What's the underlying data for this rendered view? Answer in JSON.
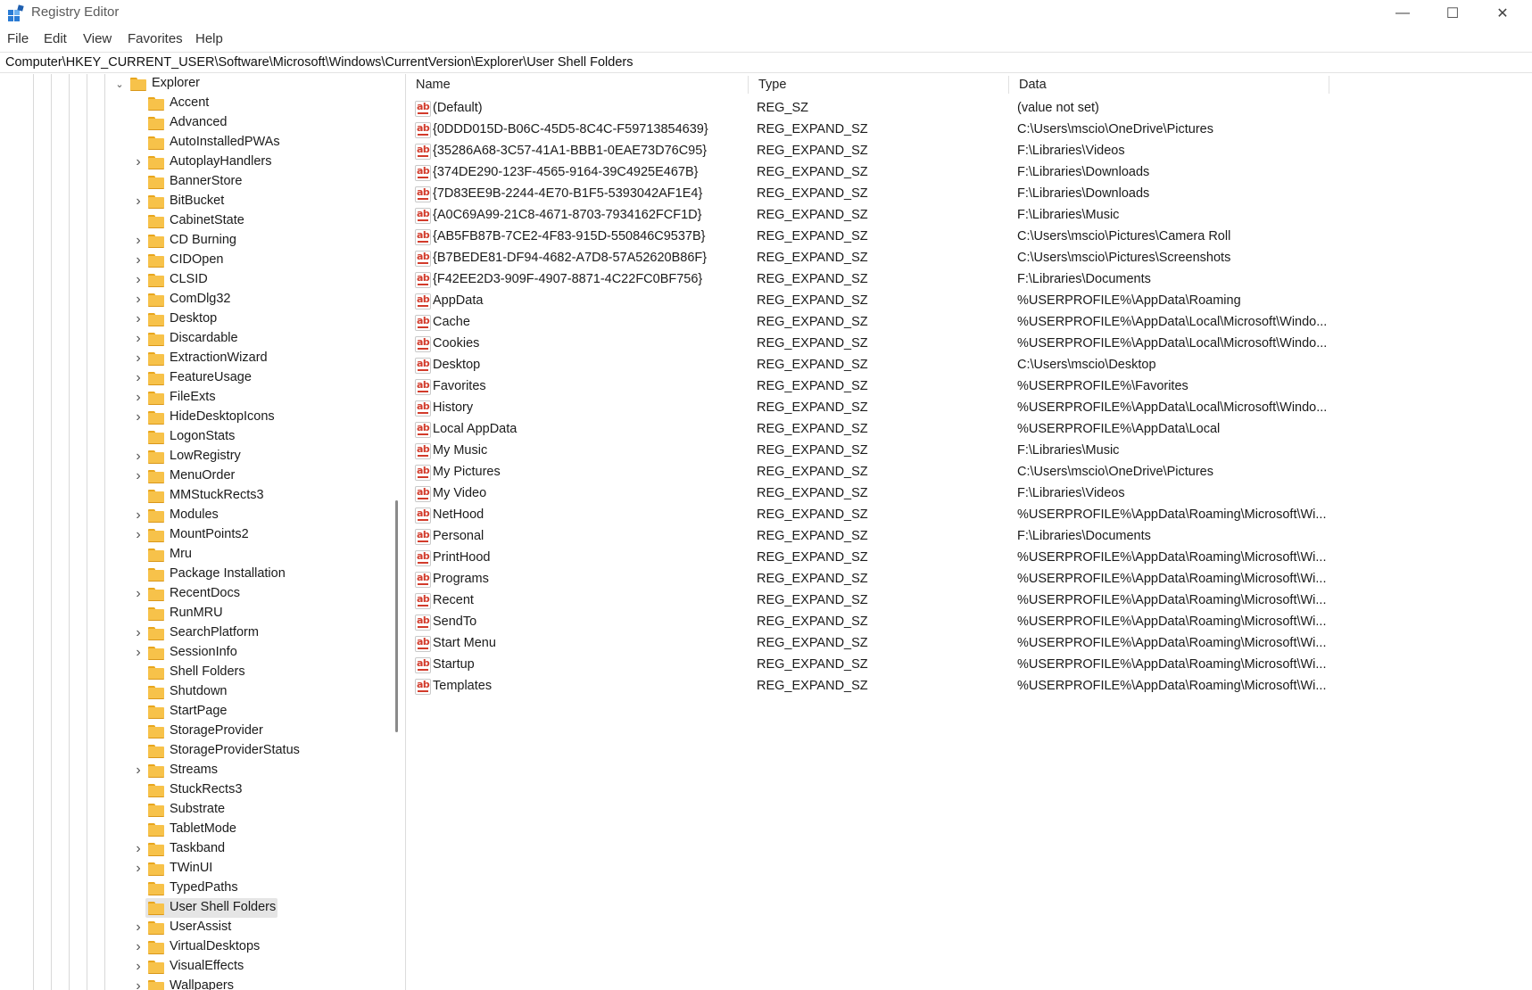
{
  "window": {
    "title": "Registry Editor",
    "minimize": "—",
    "maximize": "☐",
    "close": "✕"
  },
  "menu": [
    "File",
    "Edit",
    "View",
    "Favorites",
    "Help"
  ],
  "address": "Computer\\HKEY_CURRENT_USER\\Software\\Microsoft\\Windows\\CurrentVersion\\Explorer\\User Shell Folders",
  "tree": {
    "parent": {
      "label": "Explorer",
      "expanded": true
    },
    "children": [
      {
        "label": "Accent",
        "expandable": false
      },
      {
        "label": "Advanced",
        "expandable": false
      },
      {
        "label": "AutoInstalledPWAs",
        "expandable": false
      },
      {
        "label": "AutoplayHandlers",
        "expandable": true
      },
      {
        "label": "BannerStore",
        "expandable": false
      },
      {
        "label": "BitBucket",
        "expandable": true
      },
      {
        "label": "CabinetState",
        "expandable": false
      },
      {
        "label": "CD Burning",
        "expandable": true
      },
      {
        "label": "CIDOpen",
        "expandable": true
      },
      {
        "label": "CLSID",
        "expandable": true
      },
      {
        "label": "ComDlg32",
        "expandable": true
      },
      {
        "label": "Desktop",
        "expandable": true
      },
      {
        "label": "Discardable",
        "expandable": true
      },
      {
        "label": "ExtractionWizard",
        "expandable": true
      },
      {
        "label": "FeatureUsage",
        "expandable": true
      },
      {
        "label": "FileExts",
        "expandable": true
      },
      {
        "label": "HideDesktopIcons",
        "expandable": true
      },
      {
        "label": "LogonStats",
        "expandable": false
      },
      {
        "label": "LowRegistry",
        "expandable": true
      },
      {
        "label": "MenuOrder",
        "expandable": true
      },
      {
        "label": "MMStuckRects3",
        "expandable": false
      },
      {
        "label": "Modules",
        "expandable": true
      },
      {
        "label": "MountPoints2",
        "expandable": true
      },
      {
        "label": "Mru",
        "expandable": false
      },
      {
        "label": "Package Installation",
        "expandable": false
      },
      {
        "label": "RecentDocs",
        "expandable": true
      },
      {
        "label": "RunMRU",
        "expandable": false
      },
      {
        "label": "SearchPlatform",
        "expandable": true
      },
      {
        "label": "SessionInfo",
        "expandable": true
      },
      {
        "label": "Shell Folders",
        "expandable": false
      },
      {
        "label": "Shutdown",
        "expandable": false
      },
      {
        "label": "StartPage",
        "expandable": false
      },
      {
        "label": "StorageProvider",
        "expandable": false
      },
      {
        "label": "StorageProviderStatus",
        "expandable": false
      },
      {
        "label": "Streams",
        "expandable": true
      },
      {
        "label": "StuckRects3",
        "expandable": false
      },
      {
        "label": "Substrate",
        "expandable": false
      },
      {
        "label": "TabletMode",
        "expandable": false
      },
      {
        "label": "Taskband",
        "expandable": true
      },
      {
        "label": "TWinUI",
        "expandable": true
      },
      {
        "label": "TypedPaths",
        "expandable": false
      },
      {
        "label": "User Shell Folders",
        "expandable": false,
        "selected": true
      },
      {
        "label": "UserAssist",
        "expandable": true
      },
      {
        "label": "VirtualDesktops",
        "expandable": true
      },
      {
        "label": "VisualEffects",
        "expandable": true
      },
      {
        "label": "Wallpapers",
        "expandable": true
      }
    ]
  },
  "columns": {
    "name": "Name",
    "type": "Type",
    "data": "Data"
  },
  "values": [
    {
      "name": "(Default)",
      "type": "REG_SZ",
      "data": "(value not set)"
    },
    {
      "name": "{0DDD015D-B06C-45D5-8C4C-F59713854639}",
      "type": "REG_EXPAND_SZ",
      "data": "C:\\Users\\mscio\\OneDrive\\Pictures"
    },
    {
      "name": "{35286A68-3C57-41A1-BBB1-0EAE73D76C95}",
      "type": "REG_EXPAND_SZ",
      "data": "F:\\Libraries\\Videos"
    },
    {
      "name": "{374DE290-123F-4565-9164-39C4925E467B}",
      "type": "REG_EXPAND_SZ",
      "data": "F:\\Libraries\\Downloads"
    },
    {
      "name": "{7D83EE9B-2244-4E70-B1F5-5393042AF1E4}",
      "type": "REG_EXPAND_SZ",
      "data": "F:\\Libraries\\Downloads"
    },
    {
      "name": "{A0C69A99-21C8-4671-8703-7934162FCF1D}",
      "type": "REG_EXPAND_SZ",
      "data": "F:\\Libraries\\Music"
    },
    {
      "name": "{AB5FB87B-7CE2-4F83-915D-550846C9537B}",
      "type": "REG_EXPAND_SZ",
      "data": "C:\\Users\\mscio\\Pictures\\Camera Roll"
    },
    {
      "name": "{B7BEDE81-DF94-4682-A7D8-57A52620B86F}",
      "type": "REG_EXPAND_SZ",
      "data": "C:\\Users\\mscio\\Pictures\\Screenshots"
    },
    {
      "name": "{F42EE2D3-909F-4907-8871-4C22FC0BF756}",
      "type": "REG_EXPAND_SZ",
      "data": "F:\\Libraries\\Documents"
    },
    {
      "name": "AppData",
      "type": "REG_EXPAND_SZ",
      "data": "%USERPROFILE%\\AppData\\Roaming"
    },
    {
      "name": "Cache",
      "type": "REG_EXPAND_SZ",
      "data": "%USERPROFILE%\\AppData\\Local\\Microsoft\\Windo..."
    },
    {
      "name": "Cookies",
      "type": "REG_EXPAND_SZ",
      "data": "%USERPROFILE%\\AppData\\Local\\Microsoft\\Windo..."
    },
    {
      "name": "Desktop",
      "type": "REG_EXPAND_SZ",
      "data": "C:\\Users\\mscio\\Desktop"
    },
    {
      "name": "Favorites",
      "type": "REG_EXPAND_SZ",
      "data": "%USERPROFILE%\\Favorites"
    },
    {
      "name": "History",
      "type": "REG_EXPAND_SZ",
      "data": "%USERPROFILE%\\AppData\\Local\\Microsoft\\Windo..."
    },
    {
      "name": "Local AppData",
      "type": "REG_EXPAND_SZ",
      "data": "%USERPROFILE%\\AppData\\Local"
    },
    {
      "name": "My Music",
      "type": "REG_EXPAND_SZ",
      "data": "F:\\Libraries\\Music"
    },
    {
      "name": "My Pictures",
      "type": "REG_EXPAND_SZ",
      "data": "C:\\Users\\mscio\\OneDrive\\Pictures"
    },
    {
      "name": "My Video",
      "type": "REG_EXPAND_SZ",
      "data": "F:\\Libraries\\Videos"
    },
    {
      "name": "NetHood",
      "type": "REG_EXPAND_SZ",
      "data": "%USERPROFILE%\\AppData\\Roaming\\Microsoft\\Wi..."
    },
    {
      "name": "Personal",
      "type": "REG_EXPAND_SZ",
      "data": "F:\\Libraries\\Documents"
    },
    {
      "name": "PrintHood",
      "type": "REG_EXPAND_SZ",
      "data": "%USERPROFILE%\\AppData\\Roaming\\Microsoft\\Wi..."
    },
    {
      "name": "Programs",
      "type": "REG_EXPAND_SZ",
      "data": "%USERPROFILE%\\AppData\\Roaming\\Microsoft\\Wi..."
    },
    {
      "name": "Recent",
      "type": "REG_EXPAND_SZ",
      "data": "%USERPROFILE%\\AppData\\Roaming\\Microsoft\\Wi..."
    },
    {
      "name": "SendTo",
      "type": "REG_EXPAND_SZ",
      "data": "%USERPROFILE%\\AppData\\Roaming\\Microsoft\\Wi..."
    },
    {
      "name": "Start Menu",
      "type": "REG_EXPAND_SZ",
      "data": "%USERPROFILE%\\AppData\\Roaming\\Microsoft\\Wi..."
    },
    {
      "name": "Startup",
      "type": "REG_EXPAND_SZ",
      "data": "%USERPROFILE%\\AppData\\Roaming\\Microsoft\\Wi..."
    },
    {
      "name": "Templates",
      "type": "REG_EXPAND_SZ",
      "data": "%USERPROFILE%\\AppData\\Roaming\\Microsoft\\Wi..."
    }
  ]
}
